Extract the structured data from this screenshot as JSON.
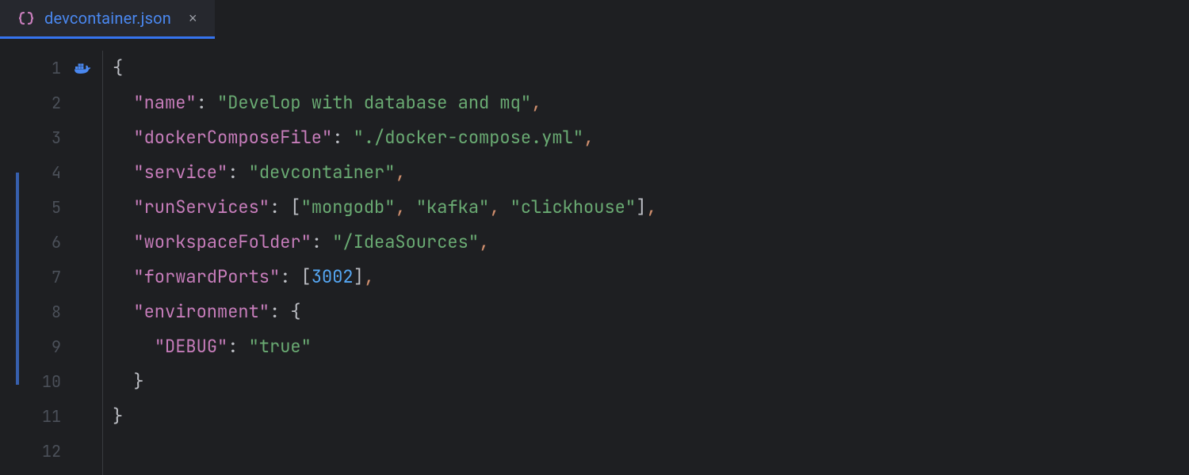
{
  "tab": {
    "filename": "devcontainer.json",
    "close_label": "×"
  },
  "gutter": {
    "lines": [
      "1",
      "2",
      "3",
      "4",
      "5",
      "6",
      "7",
      "8",
      "9",
      "10",
      "11",
      "12"
    ]
  },
  "code": {
    "indent1": "  ",
    "indent2": "    ",
    "brace_open": "{",
    "brace_close": "}",
    "bracket_open": "[",
    "bracket_close": "]",
    "comma": ",",
    "colon": ":",
    "space": " ",
    "keys": {
      "name": "\"name\"",
      "dockerComposeFile": "\"dockerComposeFile\"",
      "service": "\"service\"",
      "runServices": "\"runServices\"",
      "workspaceFolder": "\"workspaceFolder\"",
      "forwardPorts": "\"forwardPorts\"",
      "environment": "\"environment\"",
      "debug": "\"DEBUG\""
    },
    "values": {
      "name": "\"Develop with database and mq\"",
      "dockerComposeFile": "\"./docker-compose.yml\"",
      "service": "\"devcontainer\"",
      "mongodb": "\"mongodb\"",
      "kafka": "\"kafka\"",
      "clickhouse": "\"clickhouse\"",
      "workspaceFolder": "\"/IdeaSources\"",
      "forwardPort": "3002",
      "debug": "\"true\""
    }
  }
}
